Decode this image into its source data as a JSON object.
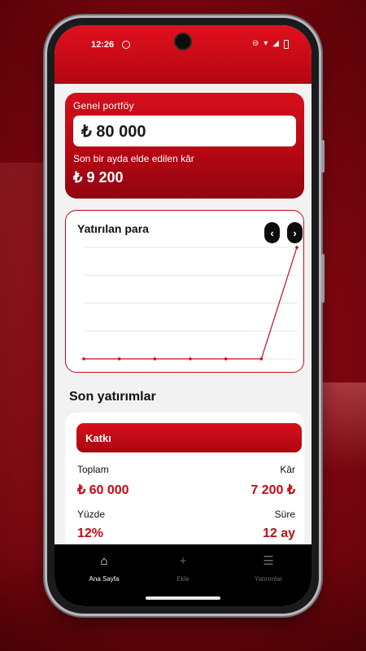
{
  "status": {
    "time": "12:26"
  },
  "portfolio": {
    "label": "Genel portföy",
    "amount": "₺ 80 000",
    "profit_label": "Son bir ayda elde edilen kâr",
    "profit_amount": "₺ 9 200"
  },
  "chart": {
    "title": "Yatırılan para",
    "prev_label": "‹",
    "next_label": "›"
  },
  "chart_data": {
    "type": "line",
    "title": "Yatırılan para",
    "series": [
      {
        "values": [
          0,
          0,
          0,
          0,
          0,
          0,
          80000
        ]
      }
    ],
    "ylim": [
      0,
      80000
    ],
    "grid": true,
    "line_color": "#c40a16"
  },
  "recent": {
    "title": "Son yatırımlar",
    "card": {
      "name": "Katkı",
      "total_label": "Toplam",
      "total_value": "₺ 60 000",
      "profit_label": "Kâr",
      "profit_value": "7 200 ₺",
      "percent_label": "Yüzde",
      "percent_value": "12%",
      "duration_label": "Süre",
      "duration_value": "12 ay"
    }
  },
  "nav": {
    "items": [
      {
        "label": "Ana Sayfa",
        "icon": "home-icon",
        "active": true
      },
      {
        "label": "Ekle",
        "icon": "plus-icon",
        "active": false
      },
      {
        "label": "Yatırımlar",
        "icon": "list-icon",
        "active": false
      }
    ]
  },
  "colors": {
    "accent": "#c40a16",
    "nav_bg": "#000000"
  }
}
